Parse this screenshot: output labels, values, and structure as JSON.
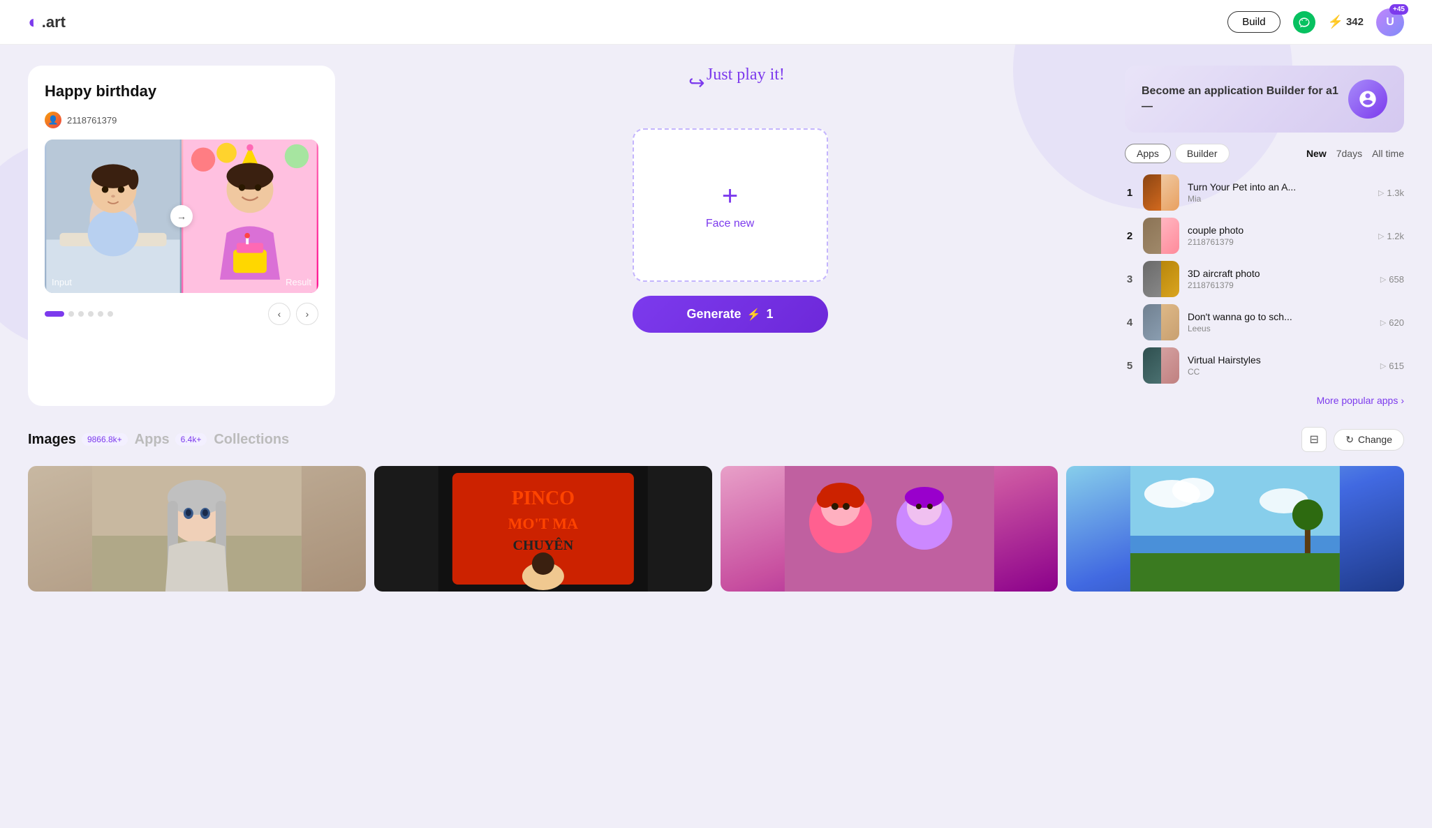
{
  "header": {
    "logo_text": ".art",
    "build_label": "Build",
    "lightning_count": "342",
    "plus_badge": "+45"
  },
  "hero": {
    "title": "Happy birthday",
    "user_id": "2118761379",
    "just_play": "Just play it!",
    "input_label": "Input",
    "result_label": "Result",
    "face_new_label": "Face new",
    "generate_label": "Generate",
    "generate_cost": "1"
  },
  "sidebar": {
    "become_title": "Become an application\nBuilder for a1—",
    "tabs": [
      "Apps",
      "Builder"
    ],
    "active_tab": "Apps",
    "time_filters": [
      "New",
      "7days",
      "All time"
    ],
    "active_time": "New",
    "apps": [
      {
        "rank": "1",
        "name": "Turn Your Pet into an A...",
        "user": "Mia",
        "plays": "1.3k",
        "color1": "#8B4513",
        "color2": "#D2691E"
      },
      {
        "rank": "2",
        "name": "couple photo",
        "user": "2118761379",
        "plays": "1.2k",
        "color1": "#8B7355",
        "color2": "#FFB6C1"
      },
      {
        "rank": "3",
        "name": "3D aircraft photo",
        "user": "2118761379",
        "plays": "658",
        "color1": "#696969",
        "color2": "#B8860B"
      },
      {
        "rank": "4",
        "name": "Don't wanna go to sch...",
        "user": "Leeus",
        "plays": "620",
        "color1": "#708090",
        "color2": "#DEB887"
      },
      {
        "rank": "5",
        "name": "Virtual Hairstyles",
        "user": "CC",
        "plays": "615",
        "color1": "#2F4F4F",
        "color2": "#D4A0A0"
      }
    ],
    "more_apps": "More popular apps"
  },
  "bottom": {
    "tabs": [
      {
        "label": "Images",
        "badge": "9866.8k+",
        "active": true
      },
      {
        "label": "Apps",
        "badge": "6.4k+",
        "active": false
      },
      {
        "label": "Collections",
        "badge": "",
        "active": false
      }
    ],
    "change_label": "Change"
  }
}
